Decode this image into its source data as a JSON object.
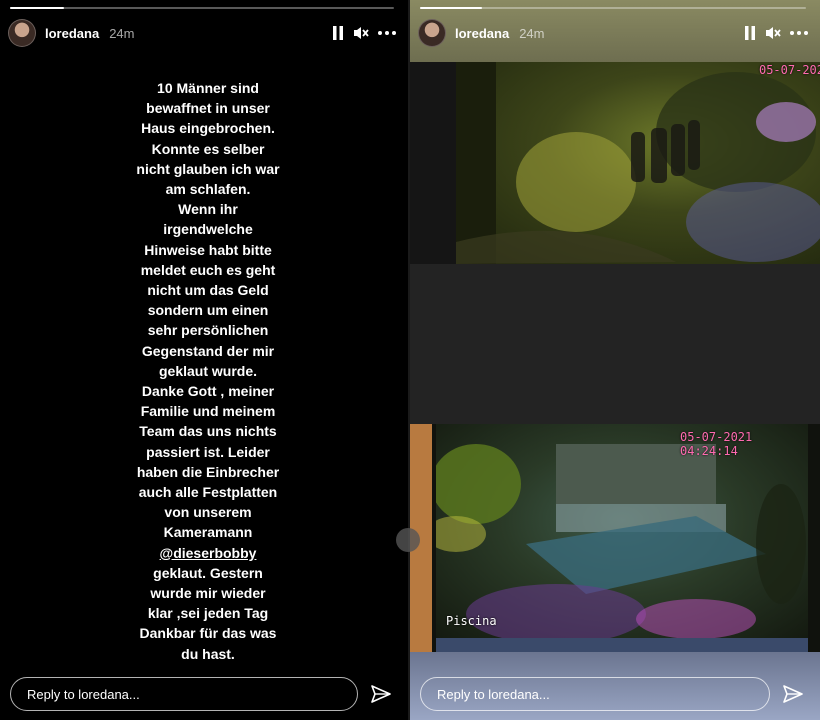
{
  "left_story": {
    "progress": 0.14,
    "username": "loredana",
    "time": "24m",
    "icons": {
      "pause": "pause-icon",
      "mute": "speaker-muted-icon",
      "more": "more-dots-icon",
      "send": "paper-plane-icon"
    },
    "text_lines": [
      "10 Männer sind",
      "bewaffnet in unser",
      "Haus eingebrochen.",
      "Konnte es selber",
      "nicht glauben ich war",
      "am schlafen.",
      "Wenn ihr",
      "irgendwelche",
      "Hinweise habt bitte",
      "meldet euch es geht",
      "nicht um das Geld",
      "sondern um einen",
      "sehr persönlichen",
      "Gegenstand der mir",
      "geklaut wurde.",
      "Danke Gott , meiner",
      "Familie und meinem",
      "Team das uns nichts",
      "passiert ist. Leider",
      "haben die Einbrecher",
      "auch alle Festplatten",
      "von unserem",
      "Kameramann",
      "@dieserbobby",
      "geklaut. Gestern",
      "wurde mir wieder",
      "klar  ,sei jeden Tag",
      "Dankbar für das was",
      "du hast."
    ],
    "reply_placeholder": "Reply to loredana..."
  },
  "right_story": {
    "progress": 0.16,
    "username": "loredana",
    "time": "24m",
    "cam1_stamp": "05-07-202",
    "cam2_stamp": "05-07-2021 04:24:14",
    "cam2_label": "Piscina",
    "reply_placeholder": "Reply to loredana..."
  },
  "colors": {
    "accent_text": "#ffffff",
    "stamp": "#ff6ab0"
  }
}
